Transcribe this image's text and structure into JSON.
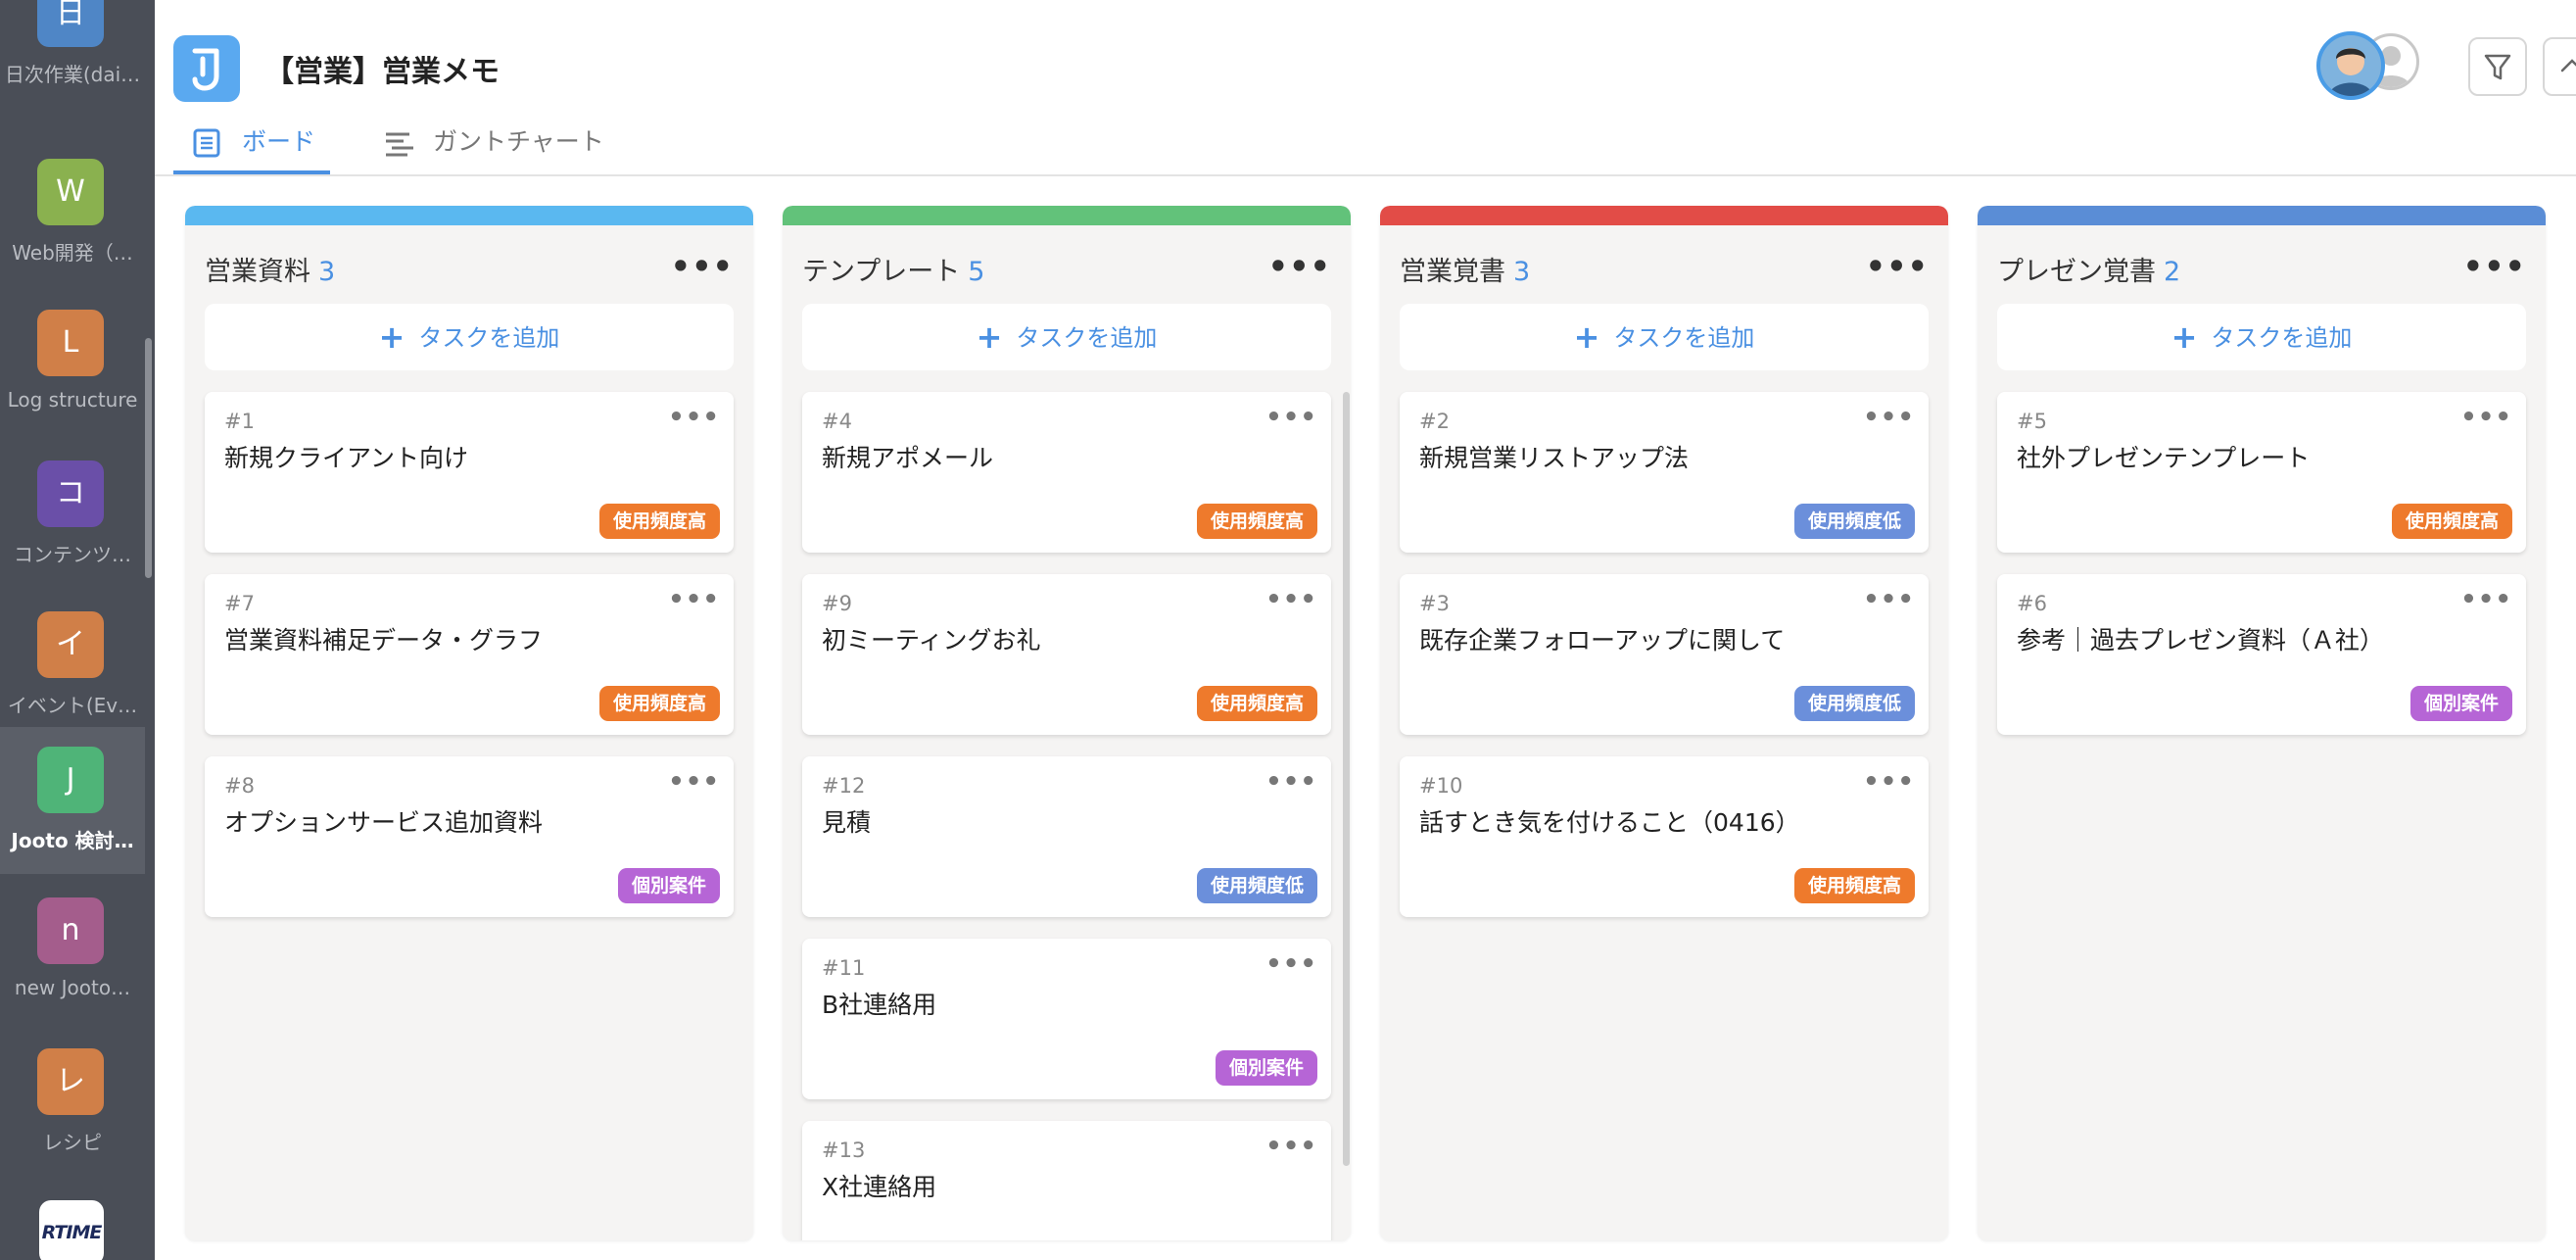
{
  "sidebar": {
    "items": [
      {
        "initial": "日",
        "label": "日次作業(dai…",
        "color": "#4f86c6"
      },
      {
        "initial": "W",
        "label": "Web開発（…",
        "color": "#8ab14f"
      },
      {
        "initial": "L",
        "label": "Log structure",
        "color": "#d07f48"
      },
      {
        "initial": "コ",
        "label": "コンテンツ…",
        "color": "#6a4fa8"
      },
      {
        "initial": "イ",
        "label": "イベント(Ev…",
        "color": "#d07f48"
      },
      {
        "initial": "J",
        "label": "Jooto 検討…",
        "color": "#4fb478"
      },
      {
        "initial": "n",
        "label": "new Jooto…",
        "color": "#a45d8c"
      },
      {
        "initial": "レ",
        "label": "レシピ",
        "color": "#d07f48"
      }
    ],
    "active_index": 5,
    "bottom_logo": "RTIME"
  },
  "header": {
    "title": "【営業】営業メモ",
    "tabs": [
      {
        "label": "ボード",
        "active": true
      },
      {
        "label": "ガントチャート",
        "active": false
      }
    ]
  },
  "board": {
    "add_task_label": "タスクを追加",
    "columns": [
      {
        "title": "営業資料",
        "count": "3",
        "color": "#5ab8f0",
        "cards": [
          {
            "id": "#1",
            "title": "新規クライアント向け",
            "tag": "使用頻度高",
            "tag_color": "#ee7a2c"
          },
          {
            "id": "#7",
            "title": "営業資料補足データ・グラフ",
            "tag": "使用頻度高",
            "tag_color": "#ee7a2c"
          },
          {
            "id": "#8",
            "title": "オプションサービス追加資料",
            "tag": "個別案件",
            "tag_color": "#b665d6"
          }
        ]
      },
      {
        "title": "テンプレート",
        "count": "5",
        "color": "#62c27a",
        "cards": [
          {
            "id": "#4",
            "title": "新規アポメール",
            "tag": "使用頻度高",
            "tag_color": "#ee7a2c"
          },
          {
            "id": "#9",
            "title": "初ミーティングお礼",
            "tag": "使用頻度高",
            "tag_color": "#ee7a2c"
          },
          {
            "id": "#12",
            "title": "見積",
            "tag": "使用頻度低",
            "tag_color": "#6b8fdb"
          },
          {
            "id": "#11",
            "title": "B社連絡用",
            "tag": "個別案件",
            "tag_color": "#b665d6"
          },
          {
            "id": "#13",
            "title": "X社連絡用",
            "tag": "",
            "tag_color": ""
          }
        ]
      },
      {
        "title": "営業覚書",
        "count": "3",
        "color": "#e24c47",
        "cards": [
          {
            "id": "#2",
            "title": "新規営業リストアップ法",
            "tag": "使用頻度低",
            "tag_color": "#6b8fdb"
          },
          {
            "id": "#3",
            "title": "既存企業フォローアップに関して",
            "tag": "使用頻度低",
            "tag_color": "#6b8fdb"
          },
          {
            "id": "#10",
            "title": "話すとき気を付けること（0416）",
            "tag": "使用頻度高",
            "tag_color": "#ee7a2c"
          }
        ]
      },
      {
        "title": "プレゼン覚書",
        "count": "2",
        "color": "#5a8dd6",
        "cards": [
          {
            "id": "#5",
            "title": "社外プレゼンテンプレート",
            "tag": "使用頻度高",
            "tag_color": "#ee7a2c"
          },
          {
            "id": "#6",
            "title": "参考｜過去プレゼン資料（Ａ社）",
            "tag": "個別案件",
            "tag_color": "#b665d6"
          }
        ]
      }
    ]
  }
}
